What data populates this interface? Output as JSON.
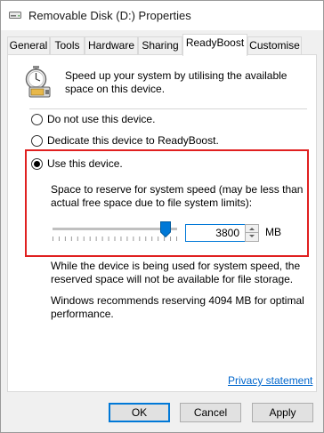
{
  "window": {
    "title": "Removable Disk (D:) Properties",
    "title_icon": "drive-icon"
  },
  "tabs": [
    {
      "label": "General",
      "active": false
    },
    {
      "label": "Tools",
      "active": false
    },
    {
      "label": "Hardware",
      "active": false
    },
    {
      "label": "Sharing",
      "active": false
    },
    {
      "label": "ReadyBoost",
      "active": true
    },
    {
      "label": "Customise",
      "active": false
    }
  ],
  "readyboost": {
    "icon": "readyboost-stopwatch-icon",
    "intro": "Speed up your system by utilising the available space on this device.",
    "options": [
      {
        "label": "Do not use this device.",
        "selected": false
      },
      {
        "label": "Dedicate this device to ReadyBoost.",
        "selected": false
      },
      {
        "label": "Use this device.",
        "selected": true
      }
    ],
    "reserve_text": "Space to reserve for system speed (may be less than actual free space due to file system limits):",
    "slider_level": 0.91,
    "reserve_value": "3800",
    "unit": "MB",
    "info_storage": "While the device is being used for system speed, the reserved space will not be available for file storage.",
    "info_recommend": "Windows recommends reserving 4094 MB for optimal performance.",
    "privacy_link": "Privacy statement"
  },
  "buttons": {
    "ok": "OK",
    "cancel": "Cancel",
    "apply": "Apply"
  },
  "colors": {
    "highlight": "#e02020",
    "accent": "#0078d7",
    "link": "#0066cc"
  }
}
